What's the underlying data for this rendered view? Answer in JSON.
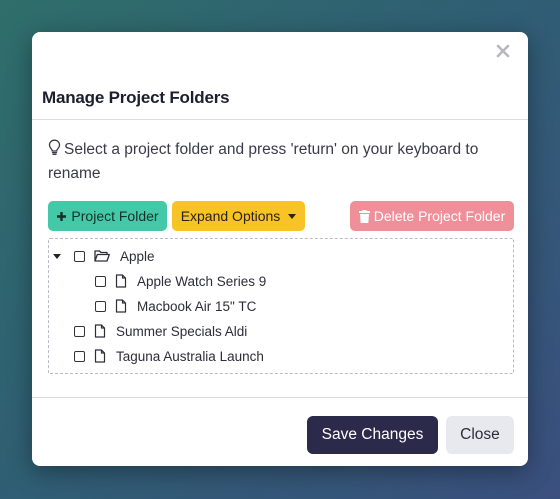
{
  "dialog": {
    "title": "Manage Project Folders",
    "hint": "Select a project folder and press 'return' on your keyboard to rename",
    "hint_icon": "lightbulb-icon",
    "close_icon": "close-icon"
  },
  "toolbar": {
    "add_label": "Project Folder",
    "add_icon": "plus-icon",
    "expand_label": "Expand Options",
    "delete_label": "Delete Project Folder",
    "delete_icon": "trash-icon"
  },
  "tree": {
    "items": [
      {
        "label": "Apple",
        "icon": "folder-open-icon",
        "expanded": true,
        "checked": false
      },
      {
        "label": "Apple Watch Series 9",
        "icon": "file-icon",
        "checked": false
      },
      {
        "label": "Macbook Air 15\" TC",
        "icon": "file-icon",
        "checked": false
      },
      {
        "label": "Summer Specials Aldi",
        "icon": "file-icon",
        "checked": false
      },
      {
        "label": "Taguna Australia Launch",
        "icon": "file-icon",
        "checked": false
      }
    ]
  },
  "footer": {
    "save_label": "Save Changes",
    "close_label": "Close"
  },
  "colors": {
    "add_button": "#44c9a8",
    "expand_button": "#f7c325",
    "delete_button": "#ef8f99",
    "save_button": "#2c2a4a",
    "close_button": "#e8e9ee"
  }
}
